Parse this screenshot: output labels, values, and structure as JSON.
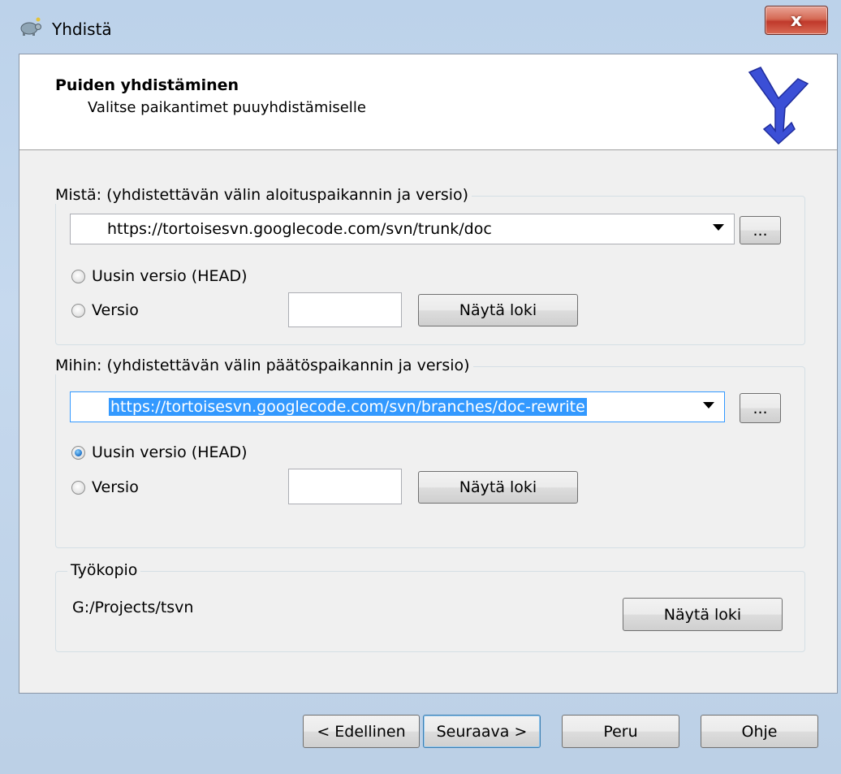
{
  "window": {
    "title": "Yhdistä",
    "close_label": "x"
  },
  "header": {
    "title": "Puiden yhdistäminen",
    "subtitle": "Valitse paikantimet puuyhdistämiselle"
  },
  "from_group": {
    "label": "Mistä: (yhdistettävän välin aloituspaikannin ja versio)",
    "url": "https://tortoisesvn.googlecode.com/svn/trunk/doc",
    "browse_label": "...",
    "radio_head_label": "Uusin versio (HEAD)",
    "radio_head_checked": false,
    "radio_rev_label": "Versio",
    "radio_rev_checked": false,
    "revision_value": "",
    "show_log_label": "Näytä loki"
  },
  "to_group": {
    "label": "Mihin: (yhdistettävän välin päätöspaikannin ja versio)",
    "url": "https://tortoisesvn.googlecode.com/svn/branches/doc-rewrite",
    "browse_label": "...",
    "radio_head_label": "Uusin versio (HEAD)",
    "radio_head_checked": true,
    "radio_rev_label": "Versio",
    "radio_rev_checked": false,
    "revision_value": "",
    "show_log_label": "Näytä loki"
  },
  "working_copy": {
    "label": "Työkopio",
    "path": "G:/Projects/tsvn",
    "show_log_label": "Näytä loki"
  },
  "footer": {
    "back_label": "< Edellinen",
    "next_label": "Seuraava >",
    "cancel_label": "Peru",
    "help_label": "Ohje"
  }
}
